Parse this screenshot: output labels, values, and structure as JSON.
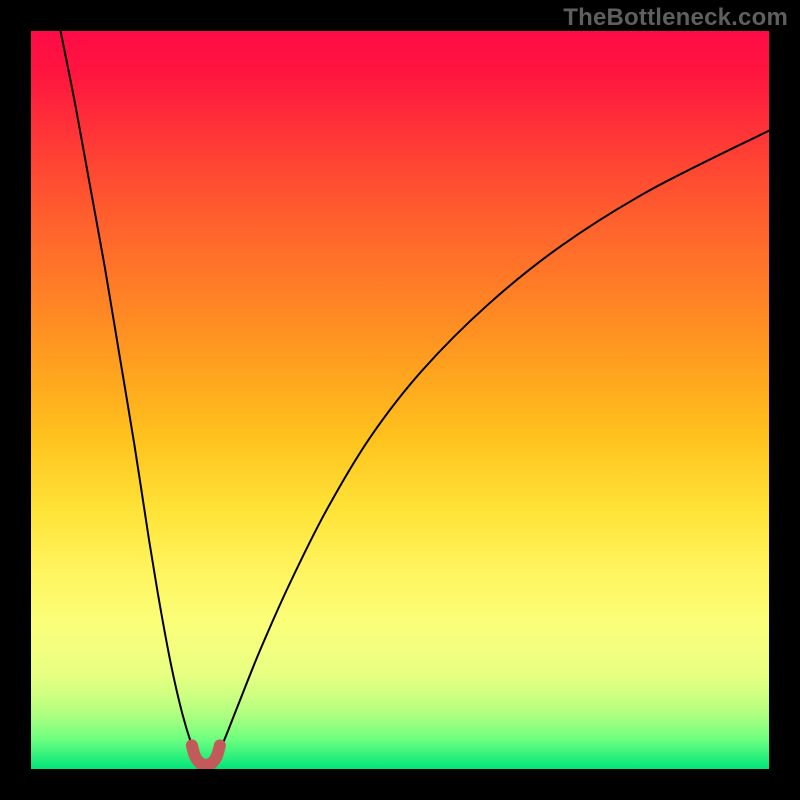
{
  "watermark": "TheBottleneck.com",
  "chart_data": {
    "type": "line",
    "title": "",
    "xlabel": "",
    "ylabel": "",
    "xlim": [
      0,
      100
    ],
    "ylim": [
      0,
      100
    ],
    "series": [
      {
        "name": "left-branch",
        "x": [
          4,
          6,
          8,
          10,
          12,
          14,
          16,
          17.5,
          19,
          20.5,
          21.8,
          22.6
        ],
        "values": [
          100,
          90,
          79,
          68,
          56,
          44,
          31,
          22,
          14,
          7.5,
          3.2,
          1.4
        ]
      },
      {
        "name": "right-branch",
        "x": [
          24.8,
          26,
          28,
          31,
          35,
          40,
          46,
          53,
          62,
          72,
          84,
          100
        ],
        "values": [
          1.4,
          3.5,
          8.5,
          16,
          25,
          35,
          45,
          54,
          63,
          71,
          78.5,
          86.5
        ]
      },
      {
        "name": "marker-trough",
        "x": [
          21.8,
          22.2,
          22.8,
          23.4,
          24.0,
          24.6,
          25.2,
          25.6
        ],
        "values": [
          3.2,
          1.8,
          0.9,
          0.6,
          0.6,
          0.9,
          1.8,
          3.2
        ]
      }
    ],
    "annotations": [],
    "legend": false,
    "grid": false
  }
}
